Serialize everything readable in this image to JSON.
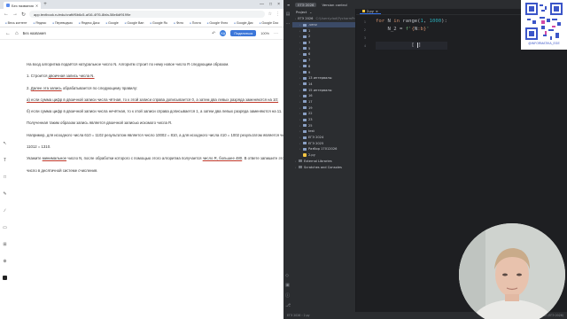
{
  "browser": {
    "tabs": [
      {
        "label": "Без названия"
      }
    ],
    "window_controls": [
      "—",
      "□",
      "×"
    ],
    "url": "app.textbook.ru/edu/craft/f6b6c5-af16-4f76-8bfa-58e6df9199e",
    "bookmarks": [
      "Весь контент",
      "Яндекс",
      "Переводчик",
      "Яндекс Диск",
      "Google",
      "Google Ван",
      "Google Ru",
      "Фото",
      "Почта",
      "Google Фото",
      "Google Дис",
      "Google Doc",
      "Блоги",
      "Спасибо",
      "Главная"
    ],
    "doc_title": "Без названия",
    "avatar": "KA",
    "share_label": "Поделиться",
    "zoom": "100%"
  },
  "document": {
    "paragraphs": [
      {
        "segments": [
          {
            "text": "На вход алгоритма подаётся натуральное число N. Алгоритм строит по нему новое число R следующим образом."
          }
        ]
      },
      {
        "segments": [
          {
            "text": "1. Строится "
          },
          {
            "text": "двоичная запись числа N.",
            "u": true
          }
        ]
      },
      {
        "segments": [
          {
            "text": "2. "
          },
          {
            "text": "Далее эта запись",
            "u": true
          },
          {
            "text": " обрабатывается по следующему правилу:"
          }
        ]
      },
      {
        "segments": [
          {
            "text": "а) если сумма цифр в двоичной записи числа чётная, то к этой записи справа дописывается 0, а затем два левых разряда заменяются на 10;",
            "u": true
          }
        ]
      },
      {
        "segments": [
          {
            "text": "б) если сумма цифр в двоичной записи числа нечётная, то к этой записи справа дописывается 1, а затем два левых разряда заменяются на 11."
          }
        ]
      },
      {
        "segments": [
          {
            "text": "Полученная таким образом запись является двоичной записью искомого числа R."
          }
        ]
      },
      {
        "segments": [
          {
            "text": "Например, для исходного числа 610 = 1102 результатом является число 10002 = 810, а для исходного числа 410 = 1002 результатом является число"
          }
        ]
      },
      {
        "segments": [
          {
            "text": "11012 = 1310."
          }
        ]
      },
      {
        "segments": [
          {
            "text": "Укажите "
          },
          {
            "text": "минимальное",
            "u": true
          },
          {
            "text": " число N, после обработки которого с помощью этого алгоритма получается "
          },
          {
            "text": "число R, большее 480",
            "u": true
          },
          {
            "text": ". В ответе запишите это"
          }
        ]
      },
      {
        "segments": [
          {
            "text": "число в десятичной системе счисления."
          }
        ]
      }
    ]
  },
  "ide": {
    "project_label": "ЕГЭ 2026",
    "vcs_label": "Version control",
    "current_file": "2.py",
    "panel_title": "Project",
    "tree": [
      {
        "label": "ЕГЭ 2026",
        "dim": "C:\\Users\\vlad\\PycharmProjects\\ЕГЭ",
        "type": "folder",
        "indent": 0
      },
      {
        "label": ".venv",
        "type": "folder",
        "indent": 1,
        "selected": true
      },
      {
        "label": "1",
        "type": "folder",
        "indent": 1
      },
      {
        "label": "2",
        "type": "folder",
        "indent": 1
      },
      {
        "label": "3",
        "type": "folder",
        "indent": 1
      },
      {
        "label": "5",
        "type": "folder",
        "indent": 1
      },
      {
        "label": "6",
        "type": "folder",
        "indent": 1
      },
      {
        "label": "7",
        "type": "folder",
        "indent": 1
      },
      {
        "label": "8",
        "type": "folder",
        "indent": 1
      },
      {
        "label": "9",
        "type": "folder",
        "indent": 1
      },
      {
        "label": "13 интервалы",
        "type": "folder",
        "indent": 1
      },
      {
        "label": "14",
        "type": "folder",
        "indent": 1
      },
      {
        "label": "15 интервалы",
        "type": "folder",
        "indent": 1
      },
      {
        "label": "16",
        "type": "folder",
        "indent": 1
      },
      {
        "label": "17",
        "type": "folder",
        "indent": 1
      },
      {
        "label": "19",
        "type": "folder",
        "indent": 1
      },
      {
        "label": "22",
        "type": "folder",
        "indent": 1
      },
      {
        "label": "23",
        "type": "folder",
        "indent": 1
      },
      {
        "label": "25",
        "type": "folder",
        "indent": 1
      },
      {
        "label": "test",
        "type": "folder",
        "indent": 1
      },
      {
        "label": "ЕГЭ 2024",
        "type": "folder",
        "indent": 1
      },
      {
        "label": "ЕГЭ 2025",
        "type": "folder",
        "indent": 1
      },
      {
        "label": "Разбор 17012026",
        "type": "folder",
        "indent": 1
      },
      {
        "label": "2.py",
        "type": "py",
        "indent": 1
      },
      {
        "label": "External Libraries",
        "type": "lib",
        "indent": 0
      },
      {
        "label": "Scratches and Consoles",
        "type": "lib",
        "indent": 0
      }
    ],
    "code_lines": [
      "1",
      "2",
      "3",
      "4"
    ],
    "statusbar_left": "ЕГЭ 2026 › 2.py",
    "statusbar_right": "4:25  CRLF  UTF-8  4 spaces  Python 3.12 (ЕГЭ 2026)"
  },
  "overlay": {
    "qr_caption": "@INFORMATIKA_EGE"
  },
  "colors": {
    "ide_bg": "#1e1f22",
    "ide_panel": "#2b2d30",
    "keyword": "#cf8e6d",
    "number": "#2aacb8",
    "string": "#6aab73",
    "underline": "#c0392b",
    "share_button": "#3b76d9"
  }
}
